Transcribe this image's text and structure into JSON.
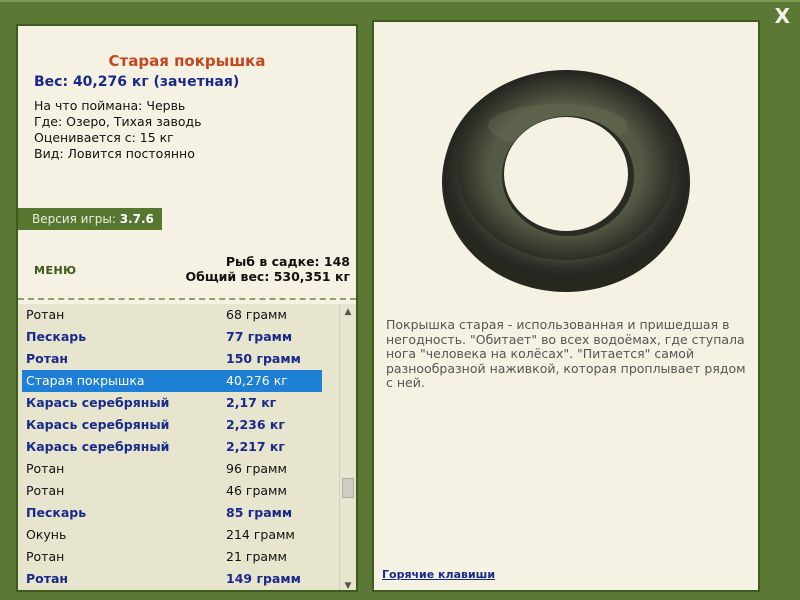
{
  "window": {
    "close_label": "X"
  },
  "fish": {
    "title": "Старая покрышка",
    "weight": "Вес: 40,276 кг (зачетная)",
    "caught_on": "На что поймана: Червь",
    "where": "Где: Озеро, Тихая заводь",
    "valued_from": "Оценивается с: 15 кг",
    "type": "Вид: Ловится постоянно"
  },
  "version": {
    "label": "Версия игры:",
    "number": "3.7.6"
  },
  "menu_label": "МЕНЮ",
  "stats": {
    "fish_in_keepnet": "Рыб в садке: 148",
    "total_weight": "Общий вес: 530,351 кг"
  },
  "catch_list": [
    {
      "name": "Ротан",
      "weight": "68 грамм",
      "bold": false,
      "selected": false
    },
    {
      "name": "Пескарь",
      "weight": "77 грамм",
      "bold": true,
      "selected": false
    },
    {
      "name": "Ротан",
      "weight": "150 грамм",
      "bold": true,
      "selected": false
    },
    {
      "name": "Старая покрышка",
      "weight": "40,276 кг",
      "bold": false,
      "selected": true
    },
    {
      "name": "Карась серебряный",
      "weight": "2,17 кг",
      "bold": true,
      "selected": false
    },
    {
      "name": "Карась серебряный",
      "weight": "2,236 кг",
      "bold": true,
      "selected": false
    },
    {
      "name": "Карась серебряный",
      "weight": "2,217 кг",
      "bold": true,
      "selected": false
    },
    {
      "name": "Ротан",
      "weight": "96 грамм",
      "bold": false,
      "selected": false
    },
    {
      "name": "Ротан",
      "weight": "46 грамм",
      "bold": false,
      "selected": false
    },
    {
      "name": "Пескарь",
      "weight": "85 грамм",
      "bold": true,
      "selected": false
    },
    {
      "name": "Окунь",
      "weight": "214 грамм",
      "bold": false,
      "selected": false
    },
    {
      "name": "Ротан",
      "weight": "21 грамм",
      "bold": false,
      "selected": false
    },
    {
      "name": "Ротан",
      "weight": "149 грамм",
      "bold": true,
      "selected": false
    }
  ],
  "description": "Покрышка старая - использованная и пришедшая в негодность. \"Обитает\" во всех водоёмах, где ступала нога \"человека на колёсах\". \"Питается\" самой разнообразной наживкой, которая проплывает рядом с ней.",
  "hotkeys_label": "Горячие клавиши",
  "colors": {
    "frame_green": "#5b7834",
    "panel_bg": "#f5f2e3",
    "title_orange": "#c4461e",
    "bold_blue": "#1a2a8a",
    "selection_blue": "#1e7fd6"
  }
}
